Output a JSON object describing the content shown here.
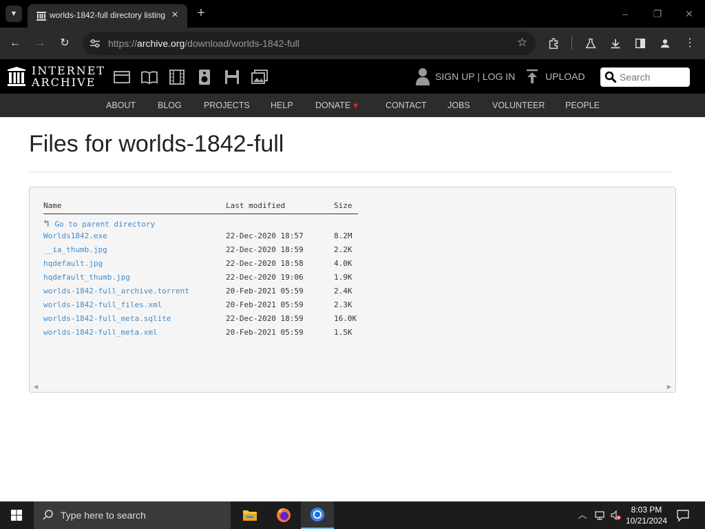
{
  "browser": {
    "tab_title": "worlds-1842-full directory listing",
    "new_tab": "+",
    "url_scheme": "https://",
    "url_host": "archive.org",
    "url_path": "/download/worlds-1842-full",
    "window_controls": {
      "minimize": "–",
      "maximize": "❐",
      "close": "✕"
    }
  },
  "ia_header": {
    "wordmark_line1": "INTERNET",
    "wordmark_line2": "ARCHIVE",
    "media_icons": [
      "web-icon",
      "texts-icon",
      "video-icon",
      "audio-icon",
      "software-icon",
      "images-icon"
    ],
    "signup_login": "SIGN UP | LOG IN",
    "upload": "UPLOAD",
    "search_placeholder": "Search"
  },
  "subnav": {
    "items": [
      "ABOUT",
      "BLOG",
      "PROJECTS",
      "HELP",
      "DONATE",
      "CONTACT",
      "JOBS",
      "VOLUNTEER",
      "PEOPLE"
    ],
    "donate_heart": "♥"
  },
  "page": {
    "title": "Files for worlds-1842-full"
  },
  "listing": {
    "headers": {
      "name": "Name",
      "modified": "Last modified",
      "size": "Size"
    },
    "parent_link": "Go to parent directory",
    "files": [
      {
        "name": "Worlds1842.exe",
        "modified": "22-Dec-2020 18:57",
        "size": "8.2M"
      },
      {
        "name": "__ia_thumb.jpg",
        "modified": "22-Dec-2020 18:59",
        "size": "2.2K"
      },
      {
        "name": "hqdefault.jpg",
        "modified": "22-Dec-2020 18:58",
        "size": "4.0K"
      },
      {
        "name": "hqdefault_thumb.jpg",
        "modified": "22-Dec-2020 19:06",
        "size": "1.9K"
      },
      {
        "name": "worlds-1842-full_archive.torrent",
        "modified": "20-Feb-2021 05:59",
        "size": "2.4K"
      },
      {
        "name": "worlds-1842-full_files.xml",
        "modified": "20-Feb-2021 05:59",
        "size": "2.3K"
      },
      {
        "name": "worlds-1842-full_meta.sqlite",
        "modified": "22-Dec-2020 18:59",
        "size": "16.0K"
      },
      {
        "name": "worlds-1842-full_meta.xml",
        "modified": "20-Feb-2021 05:59",
        "size": "1.5K"
      }
    ]
  },
  "taskbar": {
    "search_placeholder": "Type here to search",
    "time": "8:03 PM",
    "date": "10/21/2024"
  },
  "colors": {
    "link": "#428bca",
    "ia_black": "#000000",
    "subnav_bg": "#2c2c2c",
    "donate_heart": "#e8232c"
  }
}
